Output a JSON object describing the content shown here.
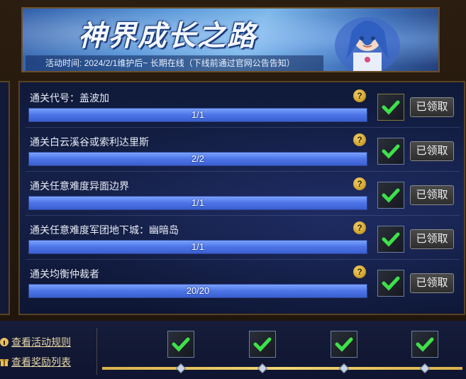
{
  "banner": {
    "title": "神界成长之路",
    "subtitle": "活动时间: 2024/2/1维护后~ 长期在线（下线前通过官网公告告知）"
  },
  "tasks": [
    {
      "label": "通关代号：盖波加",
      "progress_text": "1/1",
      "progress": 1.0,
      "button": "已领取"
    },
    {
      "label": "通关白云溪谷或索利达里斯",
      "progress_text": "2/2",
      "progress": 1.0,
      "button": "已领取"
    },
    {
      "label": "通关任意难度异面边界",
      "progress_text": "1/1",
      "progress": 1.0,
      "button": "已领取"
    },
    {
      "label": "通关任意难度军团地下城：幽暗岛",
      "progress_text": "1/1",
      "progress": 1.0,
      "button": "已领取"
    },
    {
      "label": "通关均衡仲裁者",
      "progress_text": "20/20",
      "progress": 1.0,
      "button": "已领取"
    }
  ],
  "help_glyph": "?",
  "bottom": {
    "rules_link": "查看活动规则",
    "rewards_link": "查看奖励列表"
  },
  "colors": {
    "accent_gold": "#f3d774",
    "bar_fill": "#4d74e6",
    "check_green": "#3ee04a"
  }
}
